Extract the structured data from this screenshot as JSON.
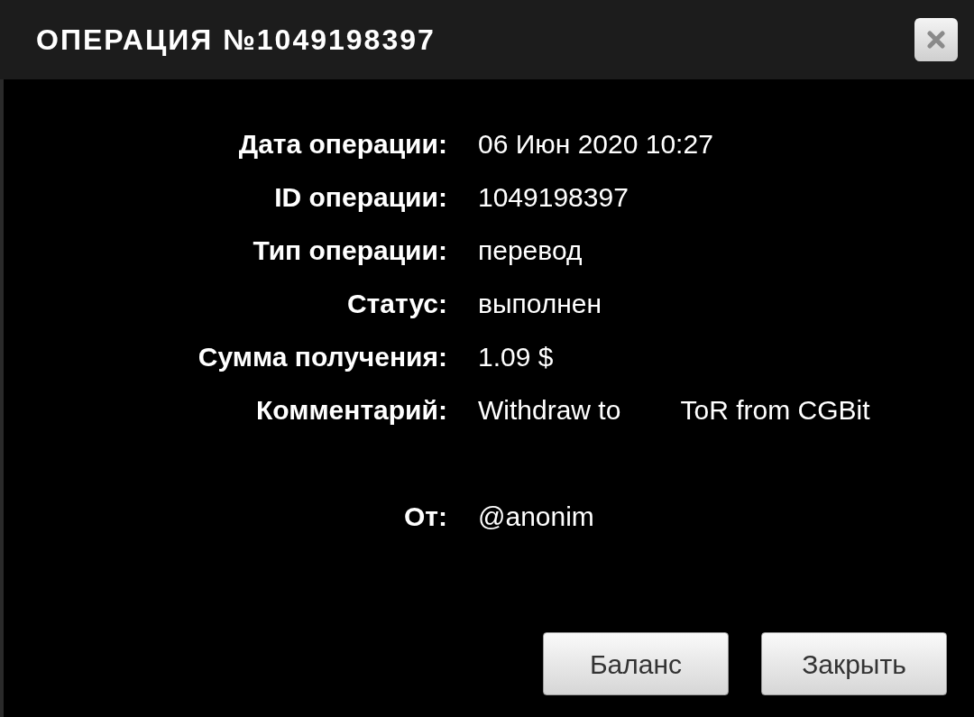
{
  "window": {
    "title": "ОПЕРАЦИЯ №1049198397"
  },
  "fields": [
    {
      "kind": "plain",
      "label": "Дата операции:",
      "value": "06 Июн 2020 10:27"
    },
    {
      "kind": "plain",
      "label": "ID операции:",
      "value": "1049198397"
    },
    {
      "kind": "plain",
      "label": "Тип операции:",
      "value": "перевод"
    },
    {
      "kind": "plain",
      "label": "Статус:",
      "value": "выполнен"
    },
    {
      "kind": "plain",
      "label": "Сумма получения:",
      "value": "1.09 $"
    },
    {
      "kind": "comment",
      "label": "Комментарий:",
      "value": "Withdraw to        ToR from CGBit"
    },
    {
      "kind": "plain",
      "label": "От:",
      "value": "@anonim"
    }
  ],
  "buttons": [
    "Баланс",
    "Закрыть"
  ]
}
